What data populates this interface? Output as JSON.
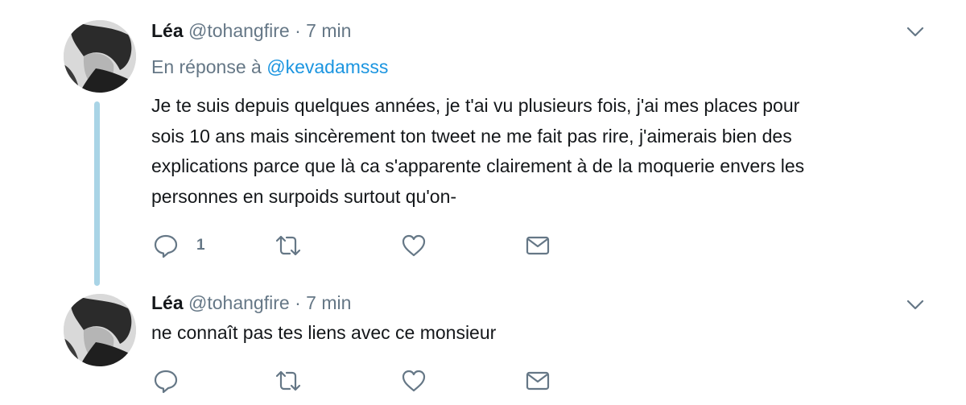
{
  "tweets": [
    {
      "author": {
        "name": "Léa",
        "handle": "@tohangfire"
      },
      "separator": "·",
      "time": "7 min",
      "reply_prefix": "En réponse à",
      "reply_mention": "@kevadamsss",
      "text_lines": [
        "Je te suis depuis quelques années, je t'ai vu plusieurs fois, j'ai mes places pour",
        "sois 10 ans mais sincèrement ton tweet ne me fait pas rire, j'aimerais bien des",
        "explications parce que là ca s'apparente clairement à de la moquerie envers les",
        "personnes en surpoids surtout qu'on-"
      ],
      "reply_count": "1",
      "icons": [
        "reply-icon",
        "retweet-icon",
        "heart-icon",
        "envelope-icon",
        "chevron-down-icon"
      ]
    },
    {
      "author": {
        "name": "Léa",
        "handle": "@tohangfire"
      },
      "separator": "·",
      "time": "7 min",
      "text_lines": [
        "ne connaît pas tes liens avec ce monsieur"
      ],
      "icons": [
        "reply-icon",
        "retweet-icon",
        "heart-icon",
        "envelope-icon",
        "chevron-down-icon"
      ]
    }
  ],
  "colors": {
    "text": "#14171a",
    "secondary": "#657786",
    "link": "#1b95e0",
    "thread_line": "#a9d4e6"
  }
}
